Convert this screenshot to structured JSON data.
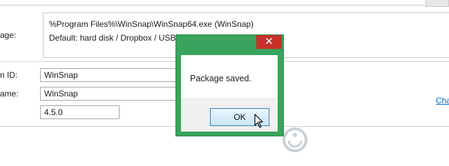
{
  "window": {
    "program_path": "%Program Files%\\WinSnap\\WinSnap64.exe (WinSnap)",
    "storage_line": "Default: hard disk / Dropbox / USB (ac",
    "storage_label": "age:"
  },
  "fields": [
    {
      "label": "n ID:",
      "value": "WinSnap"
    },
    {
      "label": "ame:",
      "value": "WinSnap"
    },
    {
      "label": "",
      "value": "4.5.0"
    }
  ],
  "change_link": "Cha",
  "dialog": {
    "message": "Package saved.",
    "ok_label": "OK",
    "close_glyph": "✕",
    "frame_color": "#3aa35d",
    "close_color": "#c7312b"
  },
  "watermark": {
    "logo": "watermark-logo-icon"
  }
}
